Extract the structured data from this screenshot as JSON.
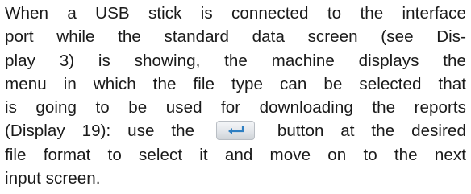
{
  "paragraph": {
    "lines": [
      "When a USB stick is connected to the interface",
      "port while the standard data screen (see Dis-",
      "play 3) is showing, the machine displays the",
      "menu in which the file type can be selected that",
      "is going to be used for downloading the reports",
      "(Display 19): use the",
      "button at the desired",
      "file format to select it and move on to the next",
      "input screen."
    ]
  },
  "icons": {
    "enter_button": "enter-return-icon"
  },
  "colors": {
    "text": "#1a1a1a",
    "icon_arrow": "#2e7fc2"
  }
}
